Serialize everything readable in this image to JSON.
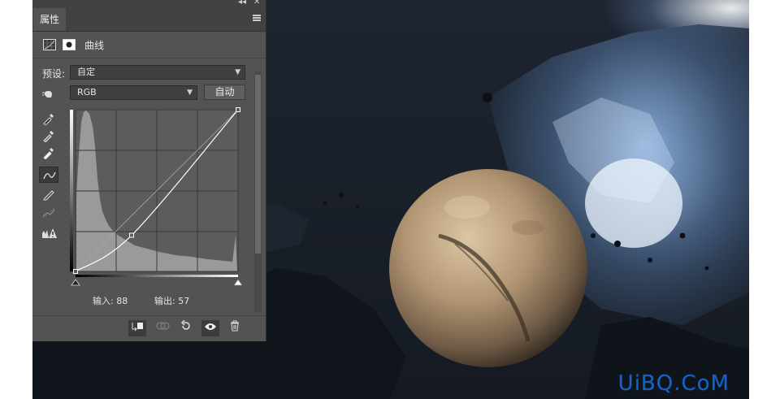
{
  "panel": {
    "tab_title": "属性",
    "adjustment_name": "曲线",
    "preset_label": "预设:",
    "preset_value": "自定",
    "channel_value": "RGB",
    "auto_button": "自动",
    "input_label": "输入:",
    "input_value": "88",
    "output_label": "输出:",
    "output_value": "57",
    "collapse_glyph": "◂◂",
    "close_glyph": "✕"
  },
  "curve": {
    "input_max": 255,
    "points": [
      {
        "input": 0,
        "output": 0
      },
      {
        "input": 88,
        "output": 57
      },
      {
        "input": 255,
        "output": 255
      }
    ]
  },
  "watermark": {
    "text": "UiBQ.CoM"
  },
  "colors": {
    "panel_bg": "#535353",
    "watermark": "#1a66c9",
    "glow": "#dce9ff"
  }
}
